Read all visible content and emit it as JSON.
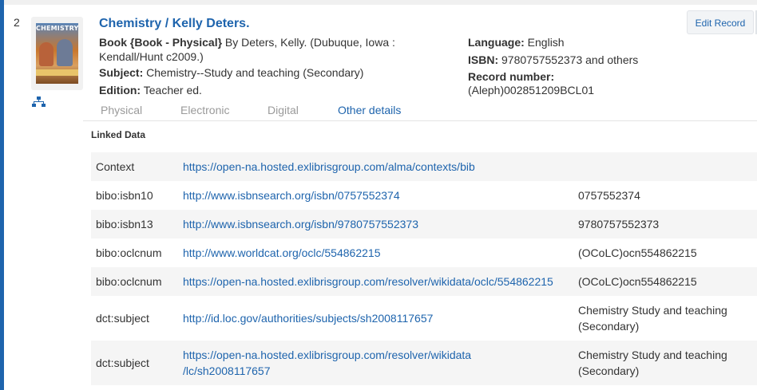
{
  "record": {
    "number": "2",
    "title": "Chemistry / Kelly Deters.",
    "edit_label": "Edit Record",
    "cover_text": "CHEMISTRY",
    "format_label": "Book {Book - Physical}",
    "author_text": " By Deters, Kelly. (Dubuque, Iowa :",
    "publisher_text": "Kendall/Hunt c2009.)",
    "subject_label": "Subject:",
    "subject_value": " Chemistry--Study and teaching (Secondary)",
    "edition_label": "Edition:",
    "edition_value": " Teacher ed.",
    "language_label": "Language:",
    "language_value": " English",
    "isbn_label": "ISBN:",
    "isbn_value": " 9780757552373 and others",
    "recnum_label": "Record number:",
    "recnum_value": "(Aleph)002851209BCL01"
  },
  "tabs": [
    "Physical",
    "Electronic",
    "Digital",
    "Other details"
  ],
  "active_tab": "Other details",
  "linked_data": {
    "title": "Linked Data",
    "rows": [
      {
        "key": "Context",
        "link": [
          "https://open-na.hosted.exlibrisgroup.com/alma/contexts/bib"
        ],
        "value": []
      },
      {
        "key": "bibo:isbn10",
        "link": [
          "http://www.isbnsearch.org/isbn/0757552374"
        ],
        "value": [
          "0757552374"
        ]
      },
      {
        "key": "bibo:isbn13",
        "link": [
          "http://www.isbnsearch.org/isbn/9780757552373"
        ],
        "value": [
          "9780757552373"
        ]
      },
      {
        "key": "bibo:oclcnum",
        "link": [
          "http://www.worldcat.org/oclc/554862215"
        ],
        "value": [
          "(OCoLC)ocn554862215"
        ]
      },
      {
        "key": "bibo:oclcnum",
        "link": [
          "https://open-na.hosted.exlibrisgroup.com/resolver/wikidata/oclc/554862215"
        ],
        "value": [
          "(OCoLC)ocn554862215"
        ]
      },
      {
        "key": "dct:subject",
        "link": [
          "http://id.loc.gov/authorities/subjects/sh2008117657"
        ],
        "value": [
          "Chemistry Study and teaching",
          "(Secondary)"
        ]
      },
      {
        "key": "dct:subject",
        "link": [
          "https://open-na.hosted.exlibrisgroup.com/resolver/wikidata",
          "/lc/sh2008117657"
        ],
        "value": [
          "Chemistry Study and teaching",
          "(Secondary)"
        ]
      }
    ]
  },
  "colors": {
    "accent": "#1e64ad",
    "row_stripe": "#f5f5f5"
  },
  "icons": {
    "hierarchy": "hierarchy-icon"
  }
}
